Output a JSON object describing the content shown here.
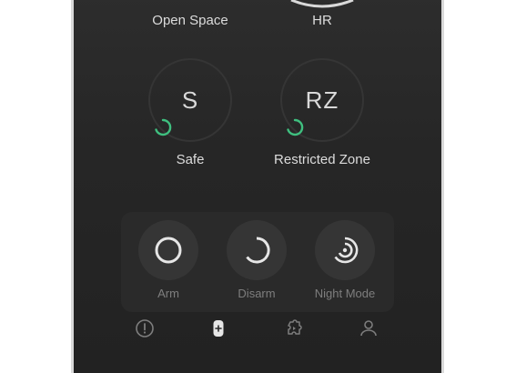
{
  "zones": [
    {
      "label": "Open Space",
      "initials": ""
    },
    {
      "label": "HR",
      "initials": ""
    },
    {
      "label": "Safe",
      "initials": "S"
    },
    {
      "label": "Restricted Zone",
      "initials": "RZ"
    }
  ],
  "actions": [
    {
      "label": "Arm",
      "icon": "circle-icon"
    },
    {
      "label": "Disarm",
      "icon": "partial-circle-icon"
    },
    {
      "label": "Night Mode",
      "icon": "night-mode-icon"
    }
  ],
  "nav": [
    {
      "icon": "alert-icon"
    },
    {
      "icon": "device-icon"
    },
    {
      "icon": "puzzle-icon"
    },
    {
      "icon": "user-icon"
    }
  ],
  "colors": {
    "accent": "#3fbf7f",
    "background": "#262626",
    "text": "#e6e6e6",
    "muted": "#7e7e7e"
  }
}
